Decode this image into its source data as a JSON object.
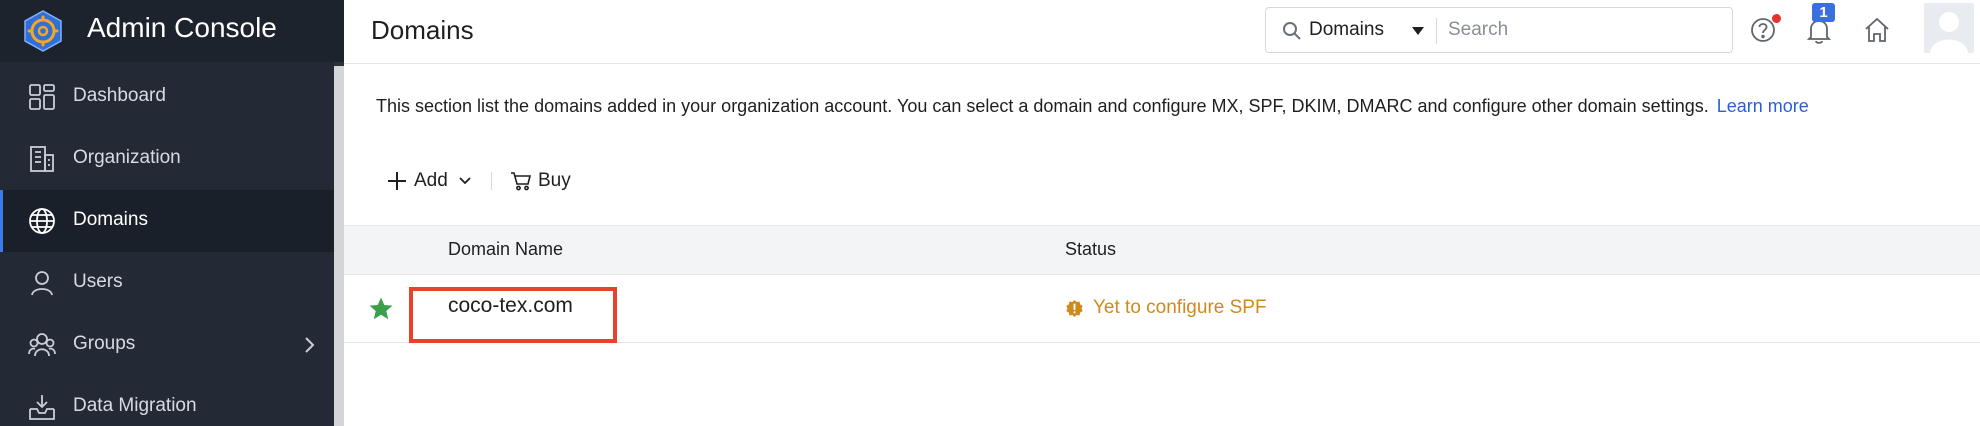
{
  "app": {
    "title": "Admin Console"
  },
  "sidebar": {
    "items": [
      {
        "label": "Dashboard",
        "icon": "dashboard-icon",
        "active": false
      },
      {
        "label": "Organization",
        "icon": "building-icon",
        "active": false
      },
      {
        "label": "Domains",
        "icon": "globe-icon",
        "active": true
      },
      {
        "label": "Users",
        "icon": "user-icon",
        "active": false
      },
      {
        "label": "Groups",
        "icon": "group-icon",
        "active": false,
        "has_submenu": true
      },
      {
        "label": "Data Migration",
        "icon": "inbox-download-icon",
        "active": false
      }
    ]
  },
  "header": {
    "page_title": "Domains",
    "search": {
      "scope": "Domains",
      "placeholder": "Search"
    },
    "notifications_count": "1",
    "icons": [
      "help-icon",
      "bell-icon",
      "home-icon",
      "avatar"
    ]
  },
  "content": {
    "description": "This section list the domains added in your organization account. You can select a domain and configure MX, SPF, DKIM, DMARC and configure other domain settings.",
    "learn_more": "Learn more",
    "toolbar": {
      "add_label": "Add",
      "buy_label": "Buy"
    },
    "table": {
      "columns": [
        "Domain Name",
        "Status"
      ],
      "rows": [
        {
          "primary": true,
          "domain": "coco-tex.com",
          "status": "Yet to configure SPF"
        }
      ]
    }
  },
  "colors": {
    "sidebar_bg": "#232a35",
    "accent": "#3b7be8",
    "link": "#2b5fd9",
    "warning": "#d08a1c",
    "star": "#3aa14a",
    "highlight_box": "#e8412c",
    "notification_badge": "#3b6fe0"
  }
}
